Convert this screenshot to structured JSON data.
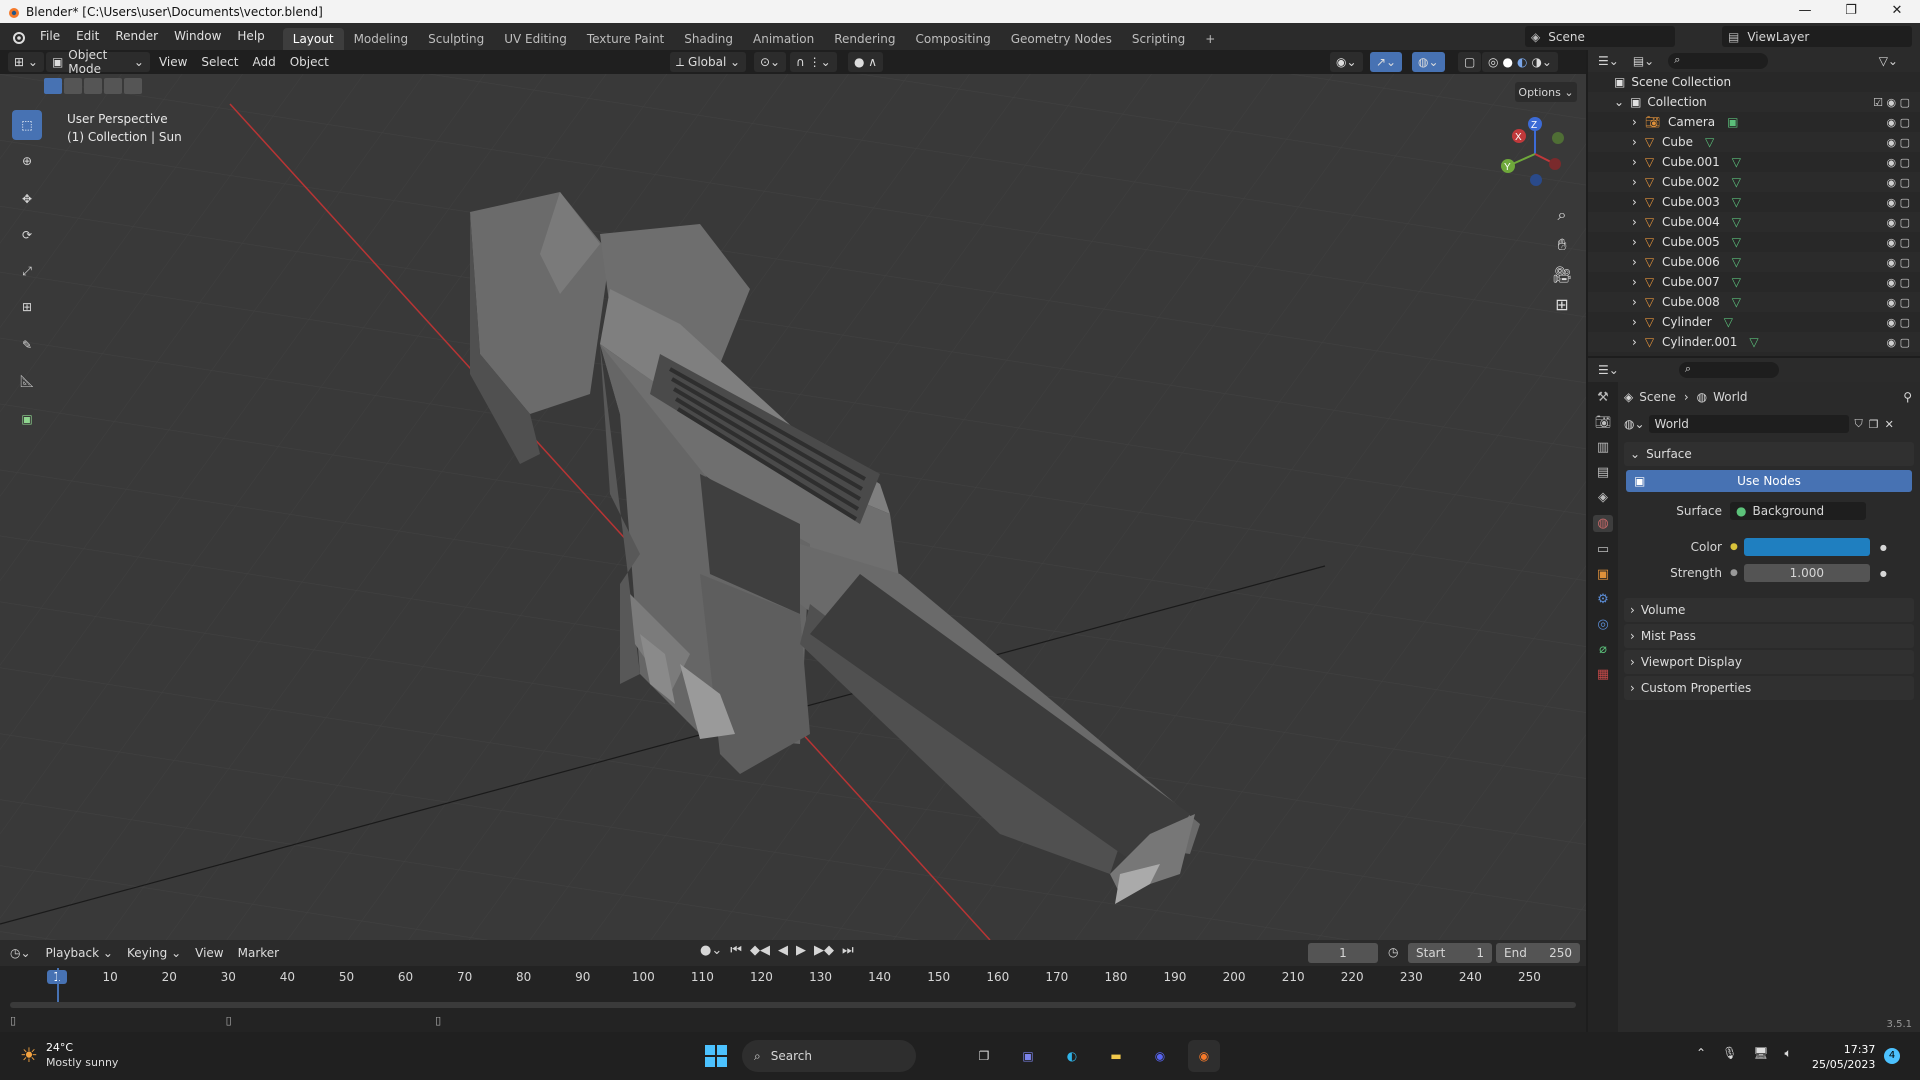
{
  "window": {
    "title": "Blender* [C:\\Users\\user\\Documents\\vector.blend]",
    "controls": [
      "—",
      "❐",
      "✕"
    ]
  },
  "topbar": {
    "menus": [
      "File",
      "Edit",
      "Render",
      "Window",
      "Help"
    ],
    "workspaces": [
      "Layout",
      "Modeling",
      "Sculpting",
      "UV Editing",
      "Texture Paint",
      "Shading",
      "Animation",
      "Rendering",
      "Compositing",
      "Geometry Nodes",
      "Scripting"
    ],
    "active_workspace": "Layout",
    "add_tab": "+",
    "scene": "Scene",
    "view_layer": "ViewLayer"
  },
  "viewport_header": {
    "mode": "Object Mode",
    "menus": [
      "View",
      "Select",
      "Add",
      "Object"
    ],
    "transform_orientation": "Global",
    "options": "Options"
  },
  "viewport": {
    "info_line1": "User Perspective",
    "info_line2": "(1) Collection | Sun",
    "gizmo": {
      "z": "Z",
      "y": "Y",
      "x": "X"
    },
    "colors": {
      "background": "#393939",
      "grid": "#444444",
      "x_axis": "#c43c3c",
      "model": "#6a6a6a"
    }
  },
  "outliner": {
    "root": "Scene Collection",
    "collection": "Collection",
    "items": [
      {
        "name": "Camera",
        "type": "camera"
      },
      {
        "name": "Cube",
        "type": "mesh"
      },
      {
        "name": "Cube.001",
        "type": "mesh"
      },
      {
        "name": "Cube.002",
        "type": "mesh"
      },
      {
        "name": "Cube.003",
        "type": "mesh"
      },
      {
        "name": "Cube.004",
        "type": "mesh"
      },
      {
        "name": "Cube.005",
        "type": "mesh"
      },
      {
        "name": "Cube.006",
        "type": "mesh"
      },
      {
        "name": "Cube.007",
        "type": "mesh"
      },
      {
        "name": "Cube.008",
        "type": "mesh"
      },
      {
        "name": "Cylinder",
        "type": "mesh"
      },
      {
        "name": "Cylinder.001",
        "type": "mesh"
      }
    ]
  },
  "properties": {
    "breadcrumb": [
      "Scene",
      "World"
    ],
    "datablock": "World",
    "surface_panel": "Surface",
    "use_nodes": "Use Nodes",
    "surface_label": "Surface",
    "surface_value": "Background",
    "color_label": "Color",
    "color_value": "#1f7fc0",
    "strength_label": "Strength",
    "strength_value": "1.000",
    "panels": [
      "Volume",
      "Mist Pass",
      "Viewport Display",
      "Custom Properties"
    ]
  },
  "timeline": {
    "menus": [
      "Playback",
      "Keying",
      "View",
      "Marker"
    ],
    "current_frame": "1",
    "start_label": "Start",
    "start_value": "1",
    "end_label": "End",
    "end_value": "250",
    "ticks": [
      "1",
      "10",
      "20",
      "30",
      "40",
      "50",
      "60",
      "70",
      "80",
      "90",
      "100",
      "110",
      "120",
      "130",
      "140",
      "150",
      "160",
      "170",
      "180",
      "190",
      "200",
      "210",
      "220",
      "230",
      "240",
      "250"
    ]
  },
  "statusbar": {
    "version": "3.5.1"
  },
  "taskbar": {
    "weather_temp": "24°C",
    "weather_desc": "Mostly sunny",
    "search": "Search",
    "time": "17:37",
    "date": "25/05/2023",
    "notifications": "4"
  }
}
